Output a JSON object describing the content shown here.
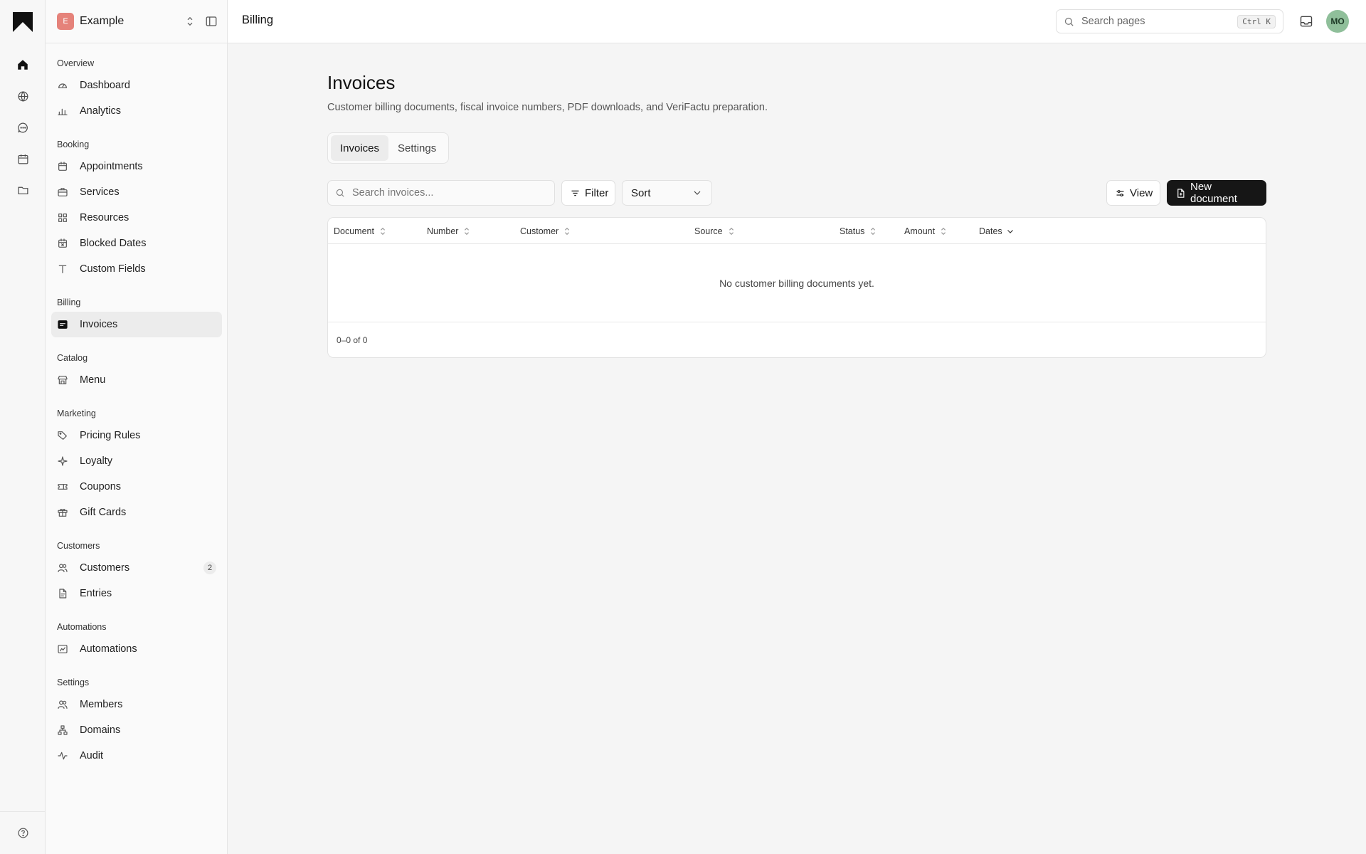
{
  "workspace": {
    "initial": "E",
    "name": "Example"
  },
  "nav": {
    "groups": [
      {
        "title": "Overview",
        "items": [
          {
            "label": "Dashboard",
            "icon": "gauge-icon"
          },
          {
            "label": "Analytics",
            "icon": "bar-chart-icon"
          }
        ]
      },
      {
        "title": "Booking",
        "items": [
          {
            "label": "Appointments",
            "icon": "calendar-icon"
          },
          {
            "label": "Services",
            "icon": "briefcase-icon"
          },
          {
            "label": "Resources",
            "icon": "grid-icon"
          },
          {
            "label": "Blocked Dates",
            "icon": "calendar-x-icon"
          },
          {
            "label": "Custom Fields",
            "icon": "text-icon"
          }
        ]
      },
      {
        "title": "Billing",
        "items": [
          {
            "label": "Invoices",
            "icon": "receipt-icon",
            "active": true
          }
        ]
      },
      {
        "title": "Catalog",
        "items": [
          {
            "label": "Menu",
            "icon": "store-icon"
          }
        ]
      },
      {
        "title": "Marketing",
        "items": [
          {
            "label": "Pricing Rules",
            "icon": "tag-icon"
          },
          {
            "label": "Loyalty",
            "icon": "sparkles-icon"
          },
          {
            "label": "Coupons",
            "icon": "ticket-icon"
          },
          {
            "label": "Gift Cards",
            "icon": "gift-icon"
          }
        ]
      },
      {
        "title": "Customers",
        "items": [
          {
            "label": "Customers",
            "icon": "users-icon",
            "count": "2"
          },
          {
            "label": "Entries",
            "icon": "file-icon"
          }
        ]
      },
      {
        "title": "Automations",
        "items": [
          {
            "label": "Automations",
            "icon": "workflow-icon"
          }
        ]
      },
      {
        "title": "Settings",
        "items": [
          {
            "label": "Members",
            "icon": "users-icon"
          },
          {
            "label": "Domains",
            "icon": "network-icon"
          },
          {
            "label": "Audit",
            "icon": "activity-icon"
          }
        ]
      }
    ]
  },
  "header": {
    "title": "Billing"
  },
  "search": {
    "placeholder": "Search pages",
    "shortcut": "Ctrl K"
  },
  "user": {
    "initials": "MO"
  },
  "page": {
    "title": "Invoices",
    "description": "Customer billing documents, fiscal invoice numbers, PDF downloads, and VeriFactu preparation.",
    "tabs": [
      {
        "label": "Invoices",
        "active": true
      },
      {
        "label": "Settings",
        "active": false
      }
    ]
  },
  "toolbar": {
    "search_placeholder": "Search invoices...",
    "filter_label": "Filter",
    "sort_label": "Sort",
    "view_label": "View",
    "new_label": "New document"
  },
  "table": {
    "columns": [
      {
        "label": "Document",
        "sort": "none"
      },
      {
        "label": "Number",
        "sort": "none"
      },
      {
        "label": "Customer",
        "sort": "none"
      },
      {
        "label": "Source",
        "sort": "none"
      },
      {
        "label": "Status",
        "sort": "none"
      },
      {
        "label": "Amount",
        "sort": "none"
      },
      {
        "label": "Dates",
        "sort": "desc"
      }
    ],
    "empty_text": "No customer billing documents yet.",
    "pagination": "0–0 of 0"
  },
  "colors": {
    "accent": "#161616",
    "workspace_badge": "#e5827a",
    "avatar": "#8fbf9a"
  }
}
